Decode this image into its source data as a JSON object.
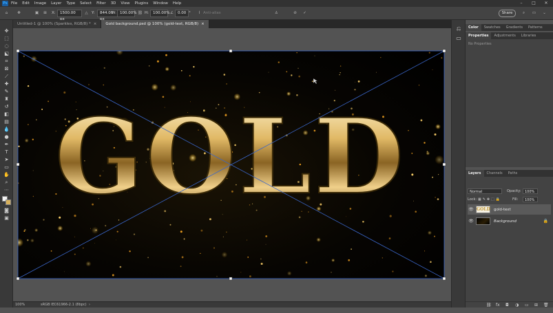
{
  "menubar": {
    "app_logo": "Ps",
    "items": [
      "File",
      "Edit",
      "Image",
      "Layer",
      "Type",
      "Select",
      "Filter",
      "3D",
      "View",
      "Plugins",
      "Window",
      "Help"
    ],
    "window_controls": [
      "–",
      "□",
      "✕"
    ]
  },
  "options_bar": {
    "x_label": "X:",
    "x_value": "1500.00 px",
    "y_label": "Y:",
    "y_value": "844.00 px",
    "w_label": "W:",
    "w_value": "100.00%",
    "h_label": "H:",
    "h_value": "100.00%",
    "angle_value": "0.00",
    "angle_unit": "°",
    "antialias_label": "Anti-alias",
    "share_label": "Share"
  },
  "tabs": [
    {
      "label": "Untitled-1 @ 100% (Sparkles, RGB/8) *"
    },
    {
      "label": "Gold background.psd @ 100% (gold-text, RGB/8)"
    }
  ],
  "canvas": {
    "headline": "GOLD"
  },
  "statusbar": {
    "zoom": "100%",
    "profile": "sRGB IEC61966-2.1 (8bpc)"
  },
  "color_panel": {
    "tabs": [
      "Color",
      "Swatches",
      "Gradients",
      "Patterns"
    ]
  },
  "properties_panel": {
    "tabs": [
      "Properties",
      "Adjustments",
      "Libraries"
    ],
    "empty_text": "No Properties"
  },
  "layers_panel": {
    "tabs": [
      "Layers",
      "Channels",
      "Paths"
    ],
    "blend_mode": "Normal",
    "opacity_label": "Opacity:",
    "opacity_value": "100%",
    "lock_label": "Lock:",
    "fill_label": "Fill:",
    "fill_value": "100%",
    "layers": [
      {
        "name": "gold-text",
        "thumb_text": "GOLD"
      },
      {
        "name": "Background"
      }
    ]
  },
  "colors": {
    "accent": "#31a8ff",
    "gold": "#d9b15a",
    "transform_line": "#3a66c9"
  }
}
